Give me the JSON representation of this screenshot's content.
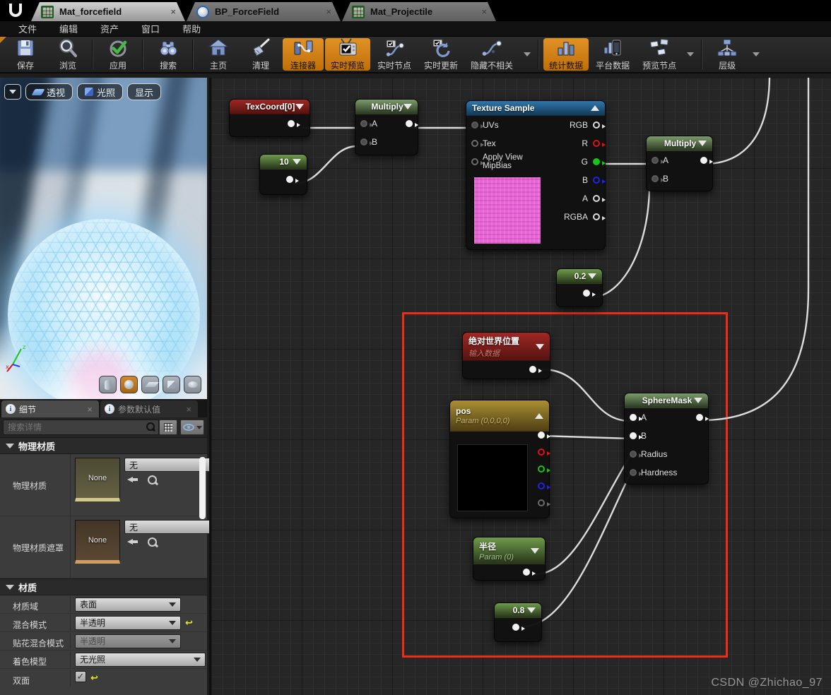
{
  "icons": {
    "close": "×",
    "reset": "↩",
    "info": "i",
    "check": "✓"
  },
  "colors": {
    "accent_orange": "#d3801f",
    "selection_red": "#ee2c17",
    "wire": "#dcdcdc",
    "canvas_bg": "#262626"
  },
  "tab_bar": {
    "tabs": [
      {
        "label": "Mat_forcefield",
        "icon": "material-asset-icon",
        "active": true
      },
      {
        "label": "BP_ForceField",
        "icon": "blueprint-asset-icon",
        "active": false
      },
      {
        "label": "Mat_Projectile",
        "icon": "material-asset-icon",
        "active": false
      }
    ]
  },
  "menu_bar": {
    "items": [
      "文件",
      "编辑",
      "资产",
      "窗口",
      "帮助"
    ]
  },
  "toolbar": {
    "buttons": [
      {
        "label": "保存",
        "icon": "save-icon",
        "active": false
      },
      {
        "label": "浏览",
        "icon": "browse-icon",
        "active": false
      },
      {
        "label": "应用",
        "icon": "apply-icon",
        "active": false
      },
      {
        "label": "搜索",
        "icon": "search-icon",
        "active": false
      },
      {
        "label": "主页",
        "icon": "home-icon",
        "active": false
      },
      {
        "label": "清理",
        "icon": "clean-icon",
        "active": false
      },
      {
        "label": "连接器",
        "icon": "connector-icon",
        "active": true
      },
      {
        "label": "实时预览",
        "icon": "live-preview-icon",
        "active": true
      },
      {
        "label": "实时节点",
        "icon": "live-node-icon",
        "active": false
      },
      {
        "label": "实时更新",
        "icon": "live-update-icon",
        "active": false
      },
      {
        "label": "隐藏不相关",
        "icon": "hide-unrelated-icon",
        "active": false
      },
      {
        "label": "统计数据",
        "icon": "stats-icon",
        "active": true
      },
      {
        "label": "平台数据",
        "icon": "platform-stats-icon",
        "active": false
      },
      {
        "label": "预览节点",
        "icon": "preview-node-icon",
        "active": false
      },
      {
        "label": "层级",
        "icon": "hierarchy-icon",
        "active": false
      }
    ]
  },
  "viewport": {
    "mode_buttons": [
      "透视",
      "光照",
      "显示"
    ],
    "shapes": [
      "cylinder",
      "sphere",
      "plane",
      "cube",
      "teapot"
    ],
    "selected_shape": "sphere"
  },
  "details": {
    "tabs": [
      {
        "label": "细节"
      },
      {
        "label": "参数默认值"
      }
    ],
    "search_placeholder": "搜索详情",
    "physical_section": {
      "title": "物理材质",
      "rows": [
        {
          "label": "物理材质",
          "thumb_label": "None",
          "value": "无"
        },
        {
          "label": "物理材质遮罩",
          "thumb_label": "None",
          "value": "无"
        }
      ]
    },
    "material_section": {
      "title": "材质",
      "rows": [
        {
          "label": "材质域",
          "value": "表面"
        },
        {
          "label": "混合模式",
          "value": "半透明"
        },
        {
          "label": "贴花混合模式",
          "value": "半透明"
        },
        {
          "label": "着色模型",
          "value": "无光照"
        },
        {
          "label": "双面",
          "checked": true
        }
      ]
    }
  },
  "graph": {
    "watermark": "CSDN @Zhichao_97",
    "nodes": {
      "texcoord": {
        "title": "TexCoord[0]"
      },
      "multiply1": {
        "title": "Multiply",
        "inputs": [
          "A",
          "B"
        ]
      },
      "texture_sample": {
        "title": "Texture Sample",
        "inputs": [
          "UVs",
          "Tex",
          "Apply View MipBias"
        ],
        "outputs": [
          "RGB",
          "R",
          "G",
          "B",
          "A",
          "RGBA"
        ]
      },
      "const10": {
        "value": "10"
      },
      "multiply2": {
        "title": "Multiply",
        "inputs": [
          "A",
          "B"
        ]
      },
      "const02": {
        "value": "0.2"
      },
      "world_position": {
        "title": "绝对世界位置",
        "subtitle": "输入数据"
      },
      "pos_param": {
        "title": "pos",
        "subtitle": "Param (0,0,0,0)"
      },
      "sphere_mask": {
        "title": "SphereMask",
        "inputs": [
          "A",
          "B",
          "Radius",
          "Hardness"
        ]
      },
      "radius_param": {
        "title": "半径",
        "subtitle": "Param (0)"
      },
      "const08": {
        "value": "0.8"
      }
    }
  }
}
